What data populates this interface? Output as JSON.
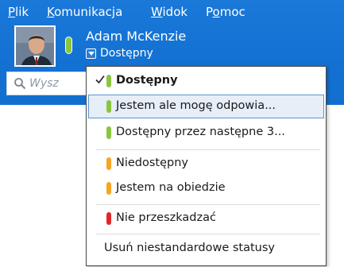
{
  "menubar": {
    "items": [
      {
        "pre": "",
        "ul": "P",
        "post": "lik"
      },
      {
        "pre": "",
        "ul": "K",
        "post": "omunikacja"
      },
      {
        "pre": "",
        "ul": "W",
        "post": "idok"
      },
      {
        "pre": "P",
        "ul": "o",
        "post": "moc"
      }
    ]
  },
  "profile": {
    "name": "Adam McKenzie",
    "status": "Dostępny",
    "presence_color": "#8bc53f"
  },
  "search": {
    "placeholder": "Wysz"
  },
  "status_menu": {
    "items": [
      {
        "label": "Dostępny",
        "color": "#8bc53f",
        "checked": true,
        "bold": true,
        "highlighted": false
      },
      {
        "label": "Jestem ale mogę odpowia...",
        "color": "#8bc53f",
        "checked": false,
        "bold": false,
        "highlighted": true
      },
      {
        "label": "Dostępny przez następne 3...",
        "color": "#8bc53f",
        "checked": false,
        "bold": false,
        "highlighted": false
      },
      {
        "label": "Niedostępny",
        "color": "#f5a623",
        "checked": false,
        "bold": false,
        "highlighted": false
      },
      {
        "label": "Jestem na obiedzie",
        "color": "#f5a623",
        "checked": false,
        "bold": false,
        "highlighted": false
      },
      {
        "label": "Nie przeszkadzać",
        "color": "#e0262b",
        "checked": false,
        "bold": false,
        "highlighted": false
      },
      {
        "label": "Usuń niestandardowe statusy",
        "color": "",
        "checked": false,
        "bold": false,
        "highlighted": false
      }
    ]
  },
  "colors": {
    "header_blue": "#1371d3",
    "available_green": "#8bc53f",
    "away_orange": "#f5a623",
    "busy_red": "#e0262b",
    "highlight_bg": "#e6eef8"
  },
  "icons": {
    "search": "search-icon",
    "check": "check-icon",
    "dropdown": "chevron-down-icon"
  }
}
